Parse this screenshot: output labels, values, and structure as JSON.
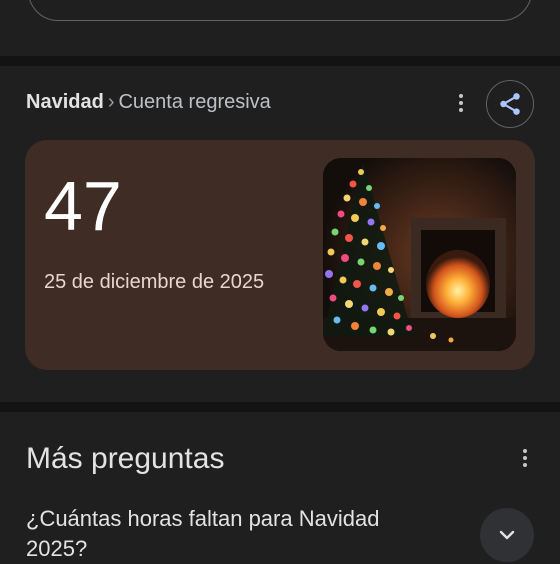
{
  "card": {
    "breadcrumb_main": "Navidad",
    "breadcrumb_separator": "›",
    "breadcrumb_sub": "Cuenta regresiva",
    "days_remaining": "47",
    "target_date": "25 de diciembre de 2025",
    "image_subject": "christmas-tree-and-fireplace",
    "panel_color": "#3e2c25"
  },
  "questions": {
    "title": "Más preguntas",
    "items": [
      {
        "text": "¿Cuántas horas faltan para Navidad 2025?"
      }
    ]
  },
  "icons": {
    "share": "share-icon",
    "more": "more-vert-icon",
    "expand": "chevron-down-icon"
  }
}
